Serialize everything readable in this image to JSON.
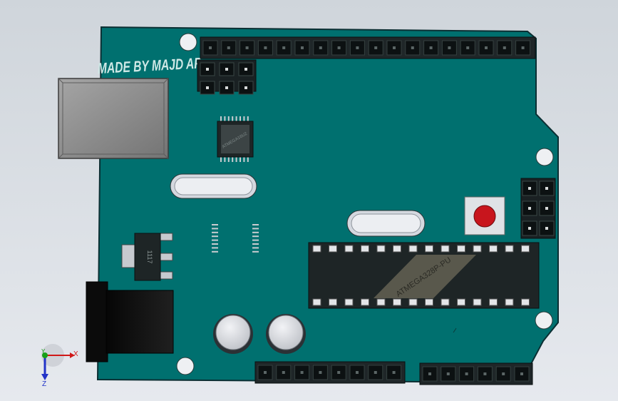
{
  "scene": {
    "board_label": "MADE BY MAJD AF",
    "chip_marking_large": "ATMEGA328P-PU",
    "chip_marking_small": "ATMEGA16U2",
    "regulator_marking": "1117",
    "colors": {
      "background_top": "#cfd5db",
      "background_bottom": "#e6e9ee",
      "pcb": "#00706f",
      "pcb_edge": "#0b2f33",
      "header": "#1f2628",
      "usb": "#8e8e8e",
      "reset_button": "#c8151d",
      "chip": "#1e2526"
    }
  },
  "triad": {
    "x_label": "X",
    "y_label": "Y",
    "z_label": "Z"
  }
}
